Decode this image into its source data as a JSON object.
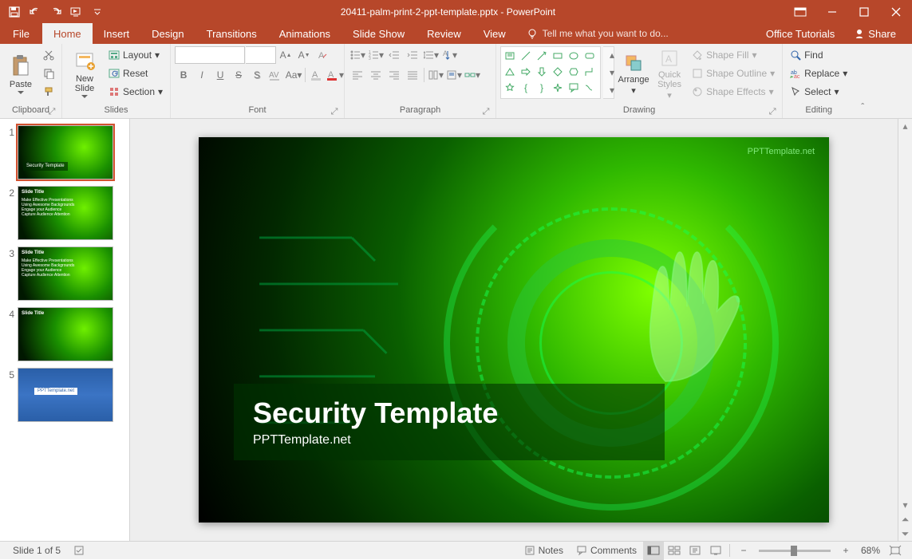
{
  "title": {
    "filename": "20411-palm-print-2-ppt-template.pptx",
    "app": "PowerPoint"
  },
  "tabs": {
    "file": "File",
    "home": "Home",
    "insert": "Insert",
    "design": "Design",
    "transitions": "Transitions",
    "animations": "Animations",
    "slideshow": "Slide Show",
    "review": "Review",
    "view": "View",
    "tellme": "Tell me what you want to do...",
    "tutorials": "Office Tutorials",
    "share": "Share"
  },
  "ribbon": {
    "clipboard": {
      "paste": "Paste",
      "label": "Clipboard"
    },
    "slides": {
      "new": "New Slide",
      "layout": "Layout",
      "reset": "Reset",
      "section": "Section",
      "label": "Slides"
    },
    "font": {
      "label": "Font"
    },
    "paragraph": {
      "label": "Paragraph"
    },
    "drawing": {
      "arrange": "Arrange",
      "quick": "Quick Styles",
      "fill": "Shape Fill",
      "outline": "Shape Outline",
      "effects": "Shape Effects",
      "label": "Drawing"
    },
    "editing": {
      "find": "Find",
      "replace": "Replace",
      "select": "Select",
      "label": "Editing"
    }
  },
  "slide": {
    "title": "Security Template",
    "subtitle": "PPTTemplate.net",
    "watermark": "PPTTemplate.net"
  },
  "thumbs": {
    "count": 5,
    "s1": {
      "title": "Security Template"
    },
    "s2": {
      "title": "Slide Title",
      "b1": "Make Effective Presentations",
      "b2": "Using Awesome Backgrounds",
      "b3": "Engage your Audience",
      "b4": "Capture Audience Attention"
    },
    "s3": {
      "title": "Slide Title",
      "b1": "Make Effective Presentations",
      "b2": "Using Awesome Backgrounds",
      "b3": "Engage your Audience",
      "b4": "Capture Audience Attention"
    },
    "s4": {
      "title": "Slide Title"
    },
    "s5": {
      "title": "PPTTemplate.net"
    }
  },
  "status": {
    "slide": "Slide 1 of 5",
    "notes": "Notes",
    "comments": "Comments",
    "zoom": "68%"
  }
}
